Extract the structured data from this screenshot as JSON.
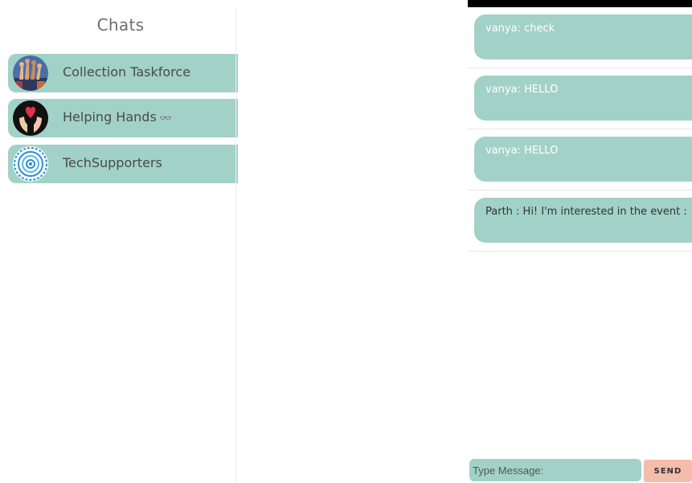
{
  "sidebar": {
    "title": "Chats",
    "items": [
      {
        "label": "Collection Taskforce",
        "icon": "raised-hands-avatar-icon"
      },
      {
        "label": "Helping Hands",
        "suffix": "👓",
        "icon": "hands-heart-avatar-icon"
      },
      {
        "label": "TechSupporters",
        "icon": "circuit-circle-avatar-icon"
      }
    ]
  },
  "chat": {
    "messages": [
      {
        "text": "vanya: check"
      },
      {
        "text": "vanya: HELLO"
      },
      {
        "text": "vanya: HELLO"
      },
      {
        "text": "Parth : Hi! I'm interested in the event :"
      }
    ],
    "input_placeholder": "Type Message:",
    "send_label": "SEND"
  },
  "colors": {
    "accent": "#a2d2c7",
    "send": "#f4bcaa",
    "topbar": "#000000"
  }
}
